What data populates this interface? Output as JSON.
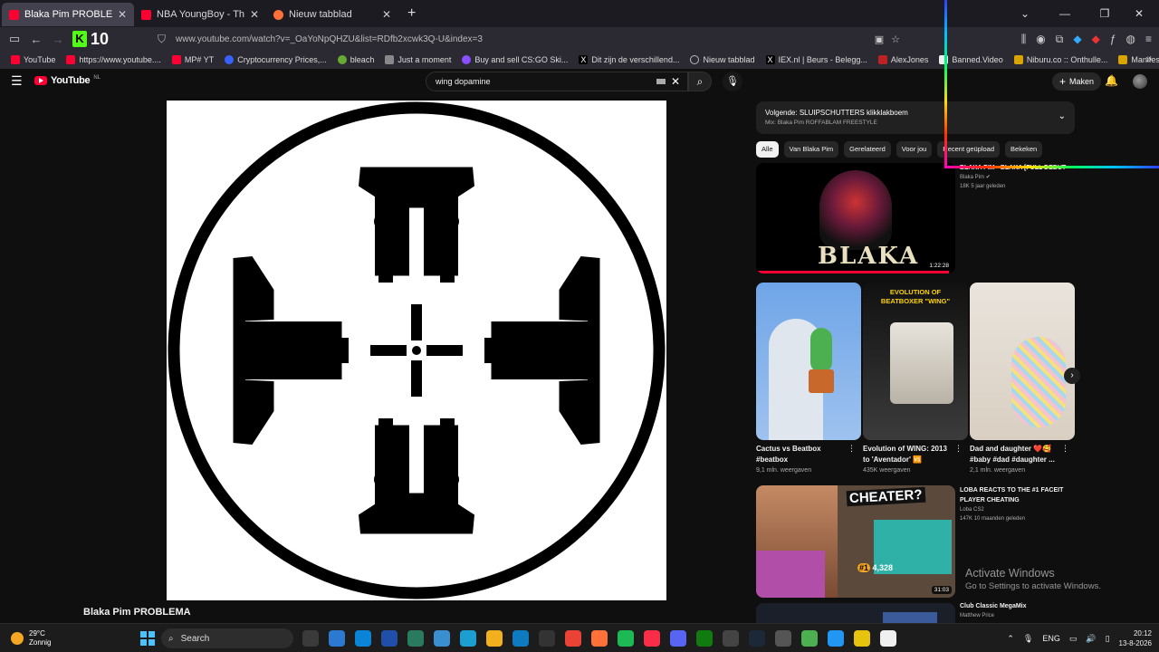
{
  "browser": {
    "tabs": [
      {
        "title": "Blaka Pim PROBLEMA - YouTube",
        "favicon_color": "#ff0033",
        "active": true
      },
      {
        "title": "NBA YoungBoy - This Not a Song",
        "favicon_color": "#ff0033",
        "active": false
      },
      {
        "title": "Nieuw tabblad",
        "favicon_color": "#ff7139",
        "active": false
      }
    ],
    "new_tab_icon": "plus-icon",
    "kick_badge": {
      "letter": "K",
      "count": "10"
    },
    "url": "www.youtube.com/watch?v=_OaYoNpQHZU&list=RDfb2xcwk3Q-U&index=3",
    "bookmarks": [
      {
        "label": "YouTube",
        "color": "#ff0033"
      },
      {
        "label": "https://www.youtube....",
        "color": "#ff0033"
      },
      {
        "label": "MP# YT",
        "color": "#ff0033"
      },
      {
        "label": "Cryptocurrency Prices,...",
        "color": "#3861fb"
      },
      {
        "label": "bleach",
        "color": "#6a3"
      },
      {
        "label": "Just a moment",
        "color": "#888"
      },
      {
        "label": "Buy and sell CS:GO Ski...",
        "color": "#8a4fff"
      },
      {
        "label": "Dit zijn de verschillend...",
        "color": "#222"
      },
      {
        "label": "Nieuw tabblad",
        "color": "#888"
      },
      {
        "label": "IEX.nl | Beurs - Belegg...",
        "color": "#222"
      },
      {
        "label": "AlexJones",
        "color": "#b22"
      },
      {
        "label": "Banned.Video",
        "color": "#eee"
      },
      {
        "label": "Niburu.co :: Onthulle...",
        "color": "#d9a400"
      },
      {
        "label": "Manifestatie — De Au...",
        "color": "#d9a400"
      }
    ]
  },
  "youtube": {
    "logo": "YouTube",
    "logo_country": "NL",
    "search_query": "wing dopamine",
    "create_label": "Maken",
    "video_title": "Blaka Pim PROBLEMA",
    "next_up": {
      "label": "Volgende: SLUIPSCHUTTERS klikklakboem",
      "mix": "Mix: Blaka Pim ROFFABLAM FREESTYLE"
    },
    "chips": [
      "Alle",
      "Van Blaka Pim",
      "Gerelateerd",
      "Voor jou",
      "Recent geüpload",
      "Bekeken"
    ],
    "video1": {
      "title": "BLAKA PIM - BLAKA [FULL DEBUT ALBUM]",
      "channel": "Blaka Pim",
      "stats": "18K  5 jaar geleden",
      "duration": "1:22:28",
      "thumb_text": "BLAKA",
      "watched_fraction": 0.97
    },
    "shorts": [
      {
        "title": "Cactus vs Beatbox #beatbox",
        "views": "9,1 mln. weergaven"
      },
      {
        "title": "Evolution of WING: 2013 to 'Aventador' 🆚",
        "views": "435K weergaven",
        "thumb_text": "EVOLUTION OF BEATBOXER \"WING\""
      },
      {
        "title": "Dad and daughter ❤️🥰 #baby #dad #daughter ...",
        "views": "2,1 mln. weergaven"
      }
    ],
    "video3": {
      "title": "LOBA REACTS TO THE #1 FACEIT PLAYER CHEATING",
      "channel": "Loba CS2",
      "stats": "147K  10 maanden geleden",
      "duration": "31:03",
      "thumb_text": "CHEATER?",
      "elo": "4,328"
    },
    "video4": {
      "title": "Club Classic MegaMix",
      "channel": "Matthew Price"
    }
  },
  "watermark": {
    "line1": "Activate Windows",
    "line2": "Go to Settings to activate Windows."
  },
  "taskbar": {
    "weather_temp": "29°C",
    "weather_desc": "Zonnig",
    "search_label": "Search",
    "language": "ENG",
    "time": "20:12",
    "date": "13-8-2026",
    "apps": [
      "#3a3a3a",
      "#2b79d0",
      "#0a84d6",
      "#1f4fa8",
      "#2a7a60",
      "#3a8fd0",
      "#1c9fd0",
      "#f2b01e",
      "#0e7ac0",
      "#333",
      "#ea4335",
      "#ff7139",
      "#1db954",
      "#fa2d48",
      "#5865f2",
      "#107c10",
      "#444",
      "#1b2838",
      "#555",
      "#4caf50",
      "#2196f3",
      "#e8c30d",
      "#f0f0f0"
    ]
  }
}
